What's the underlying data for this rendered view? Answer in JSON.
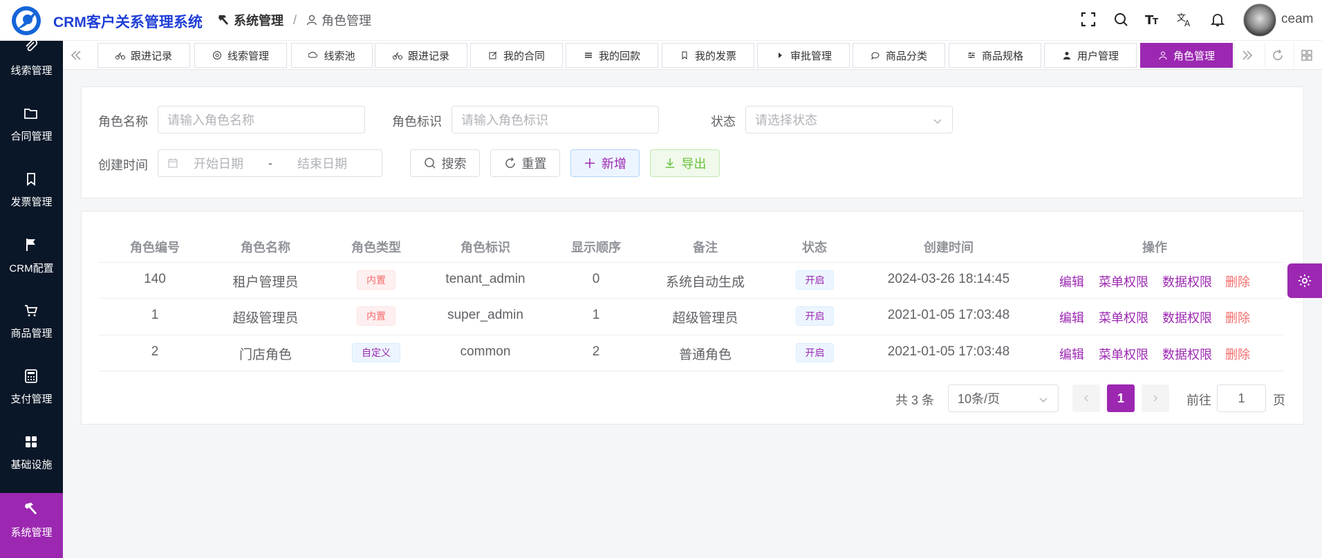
{
  "header": {
    "brand": "CRM客户关系管理系统",
    "breadcrumb": [
      "系统管理",
      "角色管理"
    ],
    "username": "ceam"
  },
  "sidebar": {
    "items": [
      {
        "label": "线索管理",
        "icon": "clip-icon"
      },
      {
        "label": "合同管理",
        "icon": "folder-icon"
      },
      {
        "label": "发票管理",
        "icon": "bookmark-icon"
      },
      {
        "label": "CRM配置",
        "icon": "flag-icon"
      },
      {
        "label": "商品管理",
        "icon": "cart-icon"
      },
      {
        "label": "支付管理",
        "icon": "calculator-icon"
      },
      {
        "label": "基础设施",
        "icon": "grid-icon"
      },
      {
        "label": "系统管理",
        "icon": "hammer-icon",
        "active": true
      }
    ]
  },
  "tabs": [
    {
      "label": "跟进记录"
    },
    {
      "label": "线索管理"
    },
    {
      "label": "线索池"
    },
    {
      "label": "跟进记录"
    },
    {
      "label": "我的合同"
    },
    {
      "label": "我的回款"
    },
    {
      "label": "我的发票"
    },
    {
      "label": "审批管理"
    },
    {
      "label": "商品分类"
    },
    {
      "label": "商品规格"
    },
    {
      "label": "用户管理"
    },
    {
      "label": "角色管理",
      "active": true
    }
  ],
  "search": {
    "role_name_label": "角色名称",
    "role_name_placeholder": "请输入角色名称",
    "role_key_label": "角色标识",
    "role_key_placeholder": "请输入角色标识",
    "status_label": "状态",
    "status_placeholder": "请选择状态",
    "created_label": "创建时间",
    "start_placeholder": "开始日期",
    "range_sep": "-",
    "end_placeholder": "结束日期",
    "search_btn": "搜索",
    "reset_btn": "重置",
    "add_btn": "新增",
    "export_btn": "导出"
  },
  "table": {
    "columns": [
      "角色编号",
      "角色名称",
      "角色类型",
      "角色标识",
      "显示顺序",
      "备注",
      "状态",
      "创建时间",
      "操作"
    ],
    "rows": [
      {
        "id": "140",
        "name": "租户管理员",
        "type": "内置",
        "type_color": "red",
        "key": "tenant_admin",
        "order": "0",
        "remark": "系统自动生成",
        "status": "开启",
        "created": "2024-03-26 18:14:45"
      },
      {
        "id": "1",
        "name": "超级管理员",
        "type": "内置",
        "type_color": "red",
        "key": "super_admin",
        "order": "1",
        "remark": "超级管理员",
        "status": "开启",
        "created": "2021-01-05 17:03:48"
      },
      {
        "id": "2",
        "name": "门店角色",
        "type": "自定义",
        "type_color": "blue",
        "key": "common",
        "order": "2",
        "remark": "普通角色",
        "status": "开启",
        "created": "2021-01-05 17:03:48"
      }
    ],
    "actions": [
      "编辑",
      "菜单权限",
      "数据权限",
      "删除"
    ]
  },
  "pagination": {
    "total": "共 3 条",
    "page_size": "10条/页",
    "current": "1",
    "goto_label": "前往",
    "goto_value": "1",
    "page_unit": "页"
  },
  "colors": {
    "accent": "#9c28b1",
    "sidebar": "#0a1728",
    "danger": "#f56c6c"
  }
}
